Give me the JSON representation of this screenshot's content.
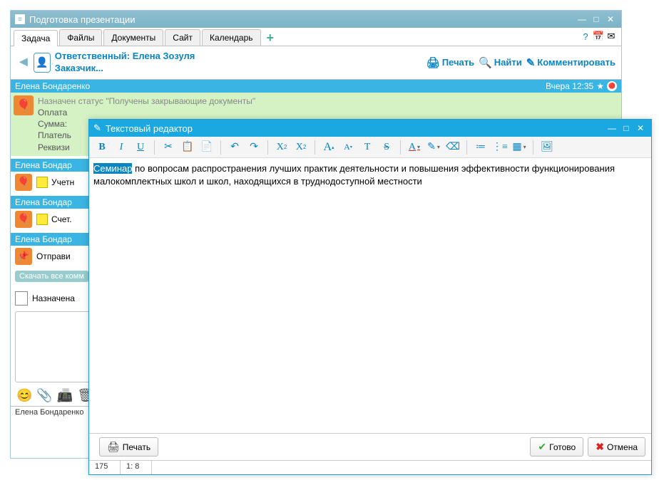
{
  "main_window": {
    "title": "Подготовка презентации",
    "tabs": [
      "Задача",
      "Файлы",
      "Документы",
      "Сайт",
      "Календарь"
    ],
    "header": {
      "responsible_label": "Ответственный: Елена Зозуля",
      "customer_label": "Заказчик...",
      "print": "Печать",
      "find": "Найти",
      "comment": "Комментировать"
    },
    "feed": {
      "item1": {
        "author": "Елена Бондаренко",
        "time": "Вчера 12:35",
        "status_line": "Назначен статус \"Получены закрывающие документы\"",
        "l1": "Оплата",
        "l2": "Сумма:",
        "l3": "Платель",
        "l4": "Реквизи"
      },
      "item2_author": "Елена Бондар",
      "item2_text": "Учетн",
      "item3_author": "Елена Бондар",
      "item3_text": "Счет.",
      "item4_author": "Елена Бондар",
      "item4_text": "Отправи",
      "download_all": "Скачать все комм",
      "assigned": "Назначена"
    },
    "status": "Елена Бондаренко"
  },
  "editor": {
    "title": "Текстовый редактор",
    "text_selected": "Семинар",
    "text_rest": " по вопросам распространения лучших практик деятельности и повышения эффективности функционирования малокомплектных школ и школ, находящихся в труднодоступной местности",
    "footer": {
      "print": "Печать",
      "done": "Готово",
      "cancel": "Отмена"
    },
    "status": {
      "chars": "175",
      "pos": "1: 8"
    }
  }
}
